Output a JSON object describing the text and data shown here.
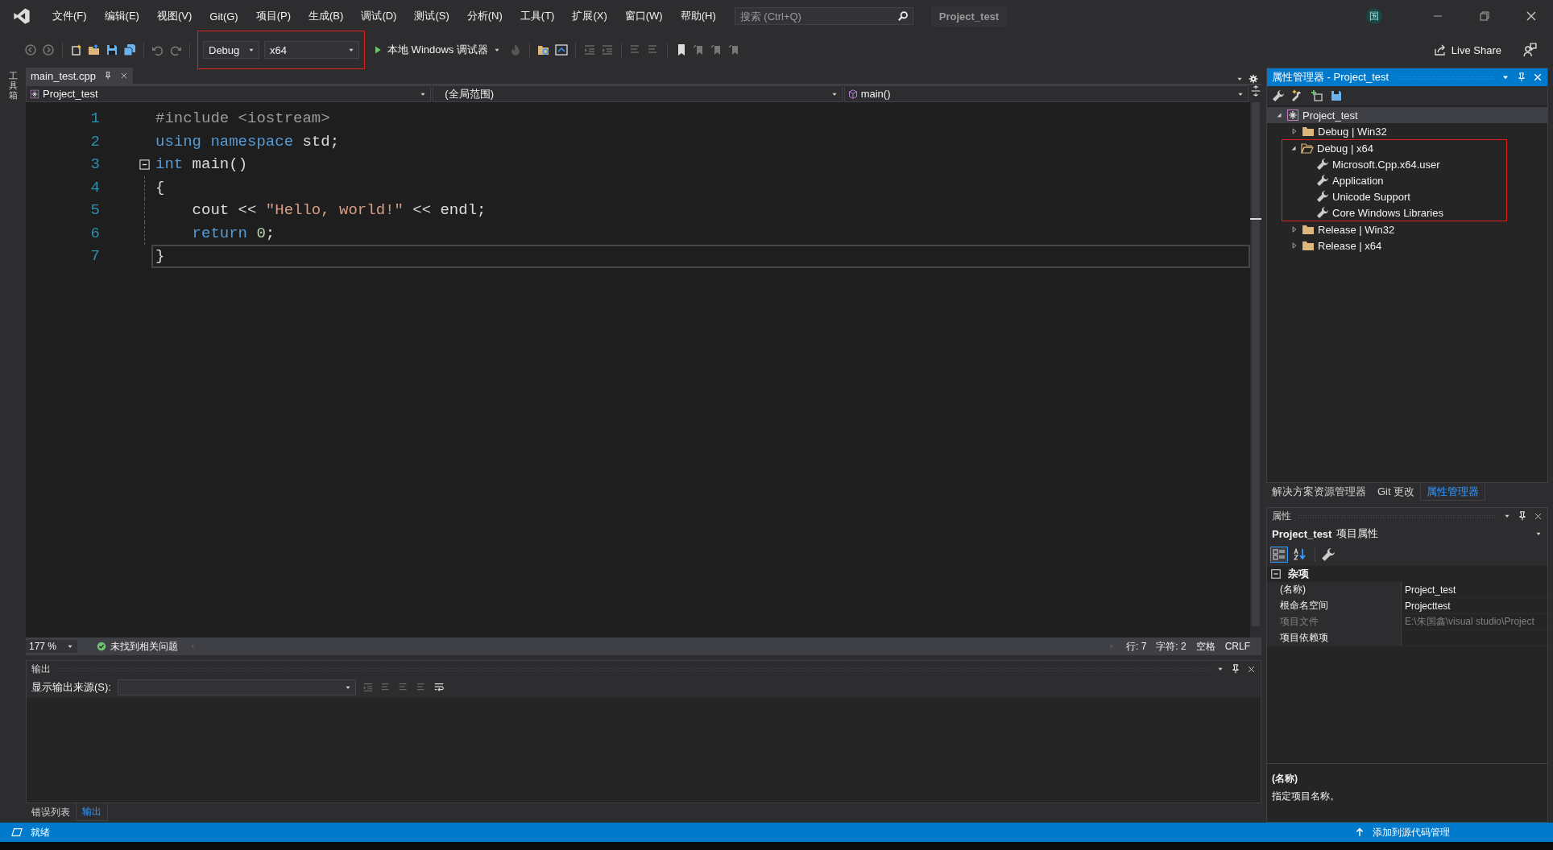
{
  "titlebar": {
    "menus": [
      "文件(F)",
      "编辑(E)",
      "视图(V)",
      "Git(G)",
      "项目(P)",
      "生成(B)",
      "调试(D)",
      "测试(S)",
      "分析(N)",
      "工具(T)",
      "扩展(X)",
      "窗口(W)",
      "帮助(H)"
    ],
    "search": {
      "placeholder": "搜索 (Ctrl+Q)"
    },
    "title": "Project_test",
    "avatar": "国"
  },
  "toolbar": {
    "configuration": "Debug",
    "platform": "x64",
    "config_highlighted": true,
    "debugger": "本地 Windows 调试器",
    "live_share": "Live Share"
  },
  "left_strip": {
    "label": "工具箱"
  },
  "editor": {
    "tab": {
      "label": "main_test.cpp",
      "selected": true
    },
    "nav": {
      "project": "Project_test",
      "scope": "(全局范围)",
      "member": "main()"
    },
    "lines": [
      {
        "number": "1",
        "fold": false,
        "guide": false,
        "current": false,
        "tokens": [
          {
            "text": "#include <iostream>",
            "kind": "preproc"
          }
        ]
      },
      {
        "number": "2",
        "fold": false,
        "guide": false,
        "current": false,
        "tokens": [
          {
            "text": "using",
            "kind": "keyword"
          },
          {
            "text": " namespace",
            "kind": "keyword"
          },
          {
            "text": " std;",
            "kind": "plain"
          }
        ]
      },
      {
        "number": "3",
        "fold": true,
        "guide": false,
        "current": false,
        "tokens": [
          {
            "text": "int",
            "kind": "keyword"
          },
          {
            "text": " main()",
            "kind": "plain"
          }
        ]
      },
      {
        "number": "4",
        "fold": false,
        "guide": true,
        "current": false,
        "tokens": [
          {
            "text": "{",
            "kind": "plain"
          }
        ]
      },
      {
        "number": "5",
        "fold": false,
        "guide": true,
        "current": false,
        "tokens": [
          {
            "text": "    cout << ",
            "kind": "plain"
          },
          {
            "text": "\"Hello, world!\"",
            "kind": "string"
          },
          {
            "text": " << endl;",
            "kind": "plain"
          }
        ]
      },
      {
        "number": "6",
        "fold": false,
        "guide": true,
        "current": false,
        "tokens": [
          {
            "text": "    return",
            "kind": "keyword"
          },
          {
            "text": " 0",
            "kind": "number"
          },
          {
            "text": ";",
            "kind": "plain"
          }
        ]
      },
      {
        "number": "7",
        "fold": false,
        "guide": false,
        "current": true,
        "tokens": [
          {
            "text": "}",
            "kind": "plain"
          }
        ]
      }
    ],
    "status": {
      "zoom": "177 %",
      "issues": "未找到相关问题",
      "line": "行: 7",
      "char": "字符: 2",
      "spaces": "空格",
      "eol": "CRLF"
    }
  },
  "output": {
    "title": "输出",
    "source_label": "显示输出来源(S):",
    "tabs": [
      {
        "label": "错误列表",
        "selected": false
      },
      {
        "label": "输出",
        "selected": true
      }
    ]
  },
  "property_manager": {
    "title": "属性管理器 - Project_test",
    "tree": [
      {
        "label": "Project_test",
        "kind": "project",
        "expanded": true,
        "selected": true,
        "highlighted": false,
        "children": [
          {
            "label": "Debug | Win32",
            "kind": "folder",
            "expanded": false,
            "selected": false,
            "highlighted": false
          },
          {
            "label": "Debug | x64",
            "kind": "folder",
            "expanded": true,
            "selected": false,
            "highlighted": true,
            "children": [
              {
                "label": "Microsoft.Cpp.x64.user",
                "kind": "sheet",
                "selected": false,
                "highlighted": false
              },
              {
                "label": "Application",
                "kind": "sheet",
                "selected": false,
                "highlighted": false
              },
              {
                "label": "Unicode Support",
                "kind": "sheet",
                "selected": false,
                "highlighted": false
              },
              {
                "label": "Core Windows Libraries",
                "kind": "sheet",
                "selected": false,
                "highlighted": false
              }
            ]
          },
          {
            "label": "Release | Win32",
            "kind": "folder",
            "expanded": false,
            "selected": false,
            "highlighted": false
          },
          {
            "label": "Release | x64",
            "kind": "folder",
            "expanded": false,
            "selected": false,
            "highlighted": false
          }
        ]
      }
    ],
    "tabs": [
      {
        "label": "解决方案资源管理器",
        "selected": false
      },
      {
        "label": "Git 更改",
        "selected": false
      },
      {
        "label": "属性管理器",
        "selected": true
      }
    ]
  },
  "properties": {
    "title": "属性",
    "object": "Project_test",
    "object_type": "项目属性",
    "view_buttons": [
      {
        "kind": "categorized",
        "selected": true
      },
      {
        "kind": "alphabetical",
        "selected": false
      }
    ],
    "category": {
      "label": "杂项",
      "expanded": true
    },
    "rows": [
      {
        "name": "(名称)",
        "value": "Project_test",
        "disabled": false
      },
      {
        "name": "根命名空间",
        "value": "Projecttest",
        "disabled": false
      },
      {
        "name": "项目文件",
        "value": "E:\\朱国鑫\\visual studio\\Project",
        "disabled": true
      },
      {
        "name": "项目依赖项",
        "disabled": false
      }
    ],
    "description": {
      "name": "(名称)",
      "text": "指定项目名称。"
    }
  },
  "status_bar": {
    "left": "就绪",
    "right": "添加到源代码管理"
  }
}
